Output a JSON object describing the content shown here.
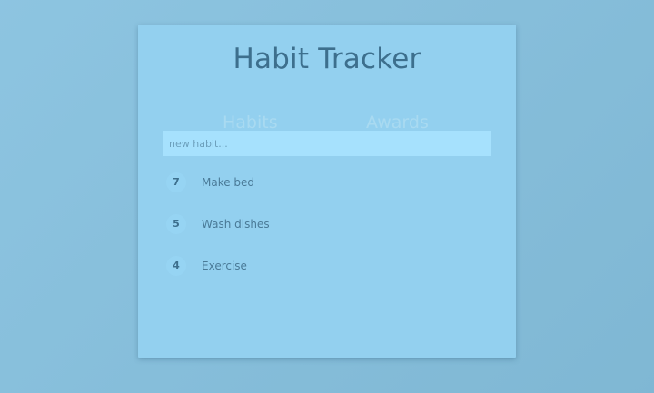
{
  "app": {
    "title": "Habit Tracker"
  },
  "tabs": [
    {
      "label": "Habits"
    },
    {
      "label": "Awards"
    }
  ],
  "new_habit": {
    "placeholder": "new habit..."
  },
  "habits": [
    {
      "count": "7",
      "name": "Make bed"
    },
    {
      "count": "5",
      "name": "Wash dishes"
    },
    {
      "count": "4",
      "name": "Exercise"
    }
  ],
  "colors": {
    "background": "#86c1df",
    "card": "#93d0ef",
    "input": "#a6e1fd",
    "title_text": "#3d6f8d",
    "inactive_tab": "#a9daf1"
  }
}
